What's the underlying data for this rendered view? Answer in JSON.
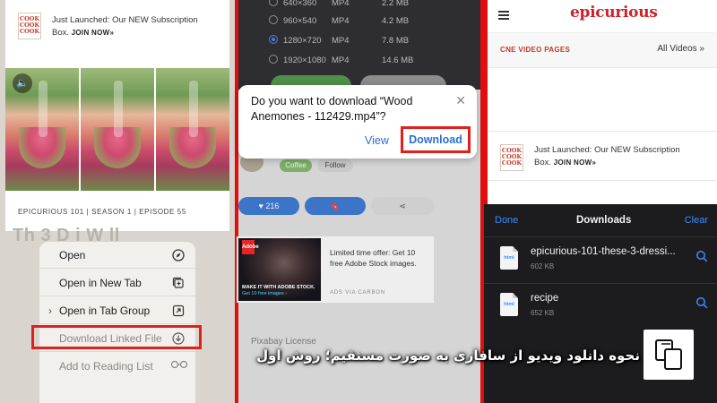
{
  "promo": {
    "logo_text": "COOK COOK COOK",
    "line1": "Just Launched: Our NEW Subscription",
    "line2": "Box.",
    "cta": "JOIN NOW»"
  },
  "left": {
    "episode": "EPICURIOUS 101 | SEASON 1 | EPISODE 55",
    "heading_ghost": "Th    3 D     i    W ll",
    "menu": [
      {
        "label": "Open",
        "icon": "compass-icon"
      },
      {
        "label": "Open in New Tab",
        "icon": "new-tab-icon"
      },
      {
        "label": "Open in Tab Group",
        "icon": "tab-group-icon"
      },
      {
        "label": "Download Linked File",
        "icon": "download-circle-icon"
      },
      {
        "label": "Add to Reading List",
        "icon": "glasses-icon"
      }
    ]
  },
  "middle": {
    "resolutions": [
      {
        "res": "640×360",
        "fmt": "MP4",
        "size": "2.2 MB",
        "selected": false
      },
      {
        "res": "960×540",
        "fmt": "MP4",
        "size": "4.2 MB",
        "selected": false
      },
      {
        "res": "1280×720",
        "fmt": "MP4",
        "size": "7.8 MB",
        "selected": true
      },
      {
        "res": "1920×1080",
        "fmt": "MP4",
        "size": "14.6 MB",
        "selected": false
      }
    ],
    "dialog": {
      "message": "Do you want to download “Wood Anemones - 112429.mp4”?",
      "view": "View",
      "download": "Download"
    },
    "tags": {
      "coffee": "Coffee",
      "follow": "Follow"
    },
    "likes": "216",
    "ad": {
      "badge": "Adobe",
      "caption": "MAKE IT WITH ADOBE STOCK.",
      "caption_sub": "Get 10 free images ›",
      "text": "Limited time offer: Get 10 free Adobe Stock images.",
      "via": "ADS VIA CARBON"
    },
    "license": "Pixabay License"
  },
  "right": {
    "brand": "epicurious",
    "nav_left": "CNE VIDEO PAGES",
    "nav_right": "All Videos »",
    "downloads": {
      "done": "Done",
      "title": "Downloads",
      "clear": "Clear",
      "items": [
        {
          "name": "epicurious-101-these-3-dressi...",
          "size": "602 KB",
          "type": "html"
        },
        {
          "name": "recipe",
          "size": "652 KB",
          "type": "html"
        }
      ]
    }
  },
  "caption": "نحوه دانلود ویدیو از سافاری به صورت مستقیم؛ روش اول",
  "colors": {
    "highlight": "#e0201c",
    "ios_blue": "#2b6fd1",
    "brand_red": "#d0202a"
  }
}
